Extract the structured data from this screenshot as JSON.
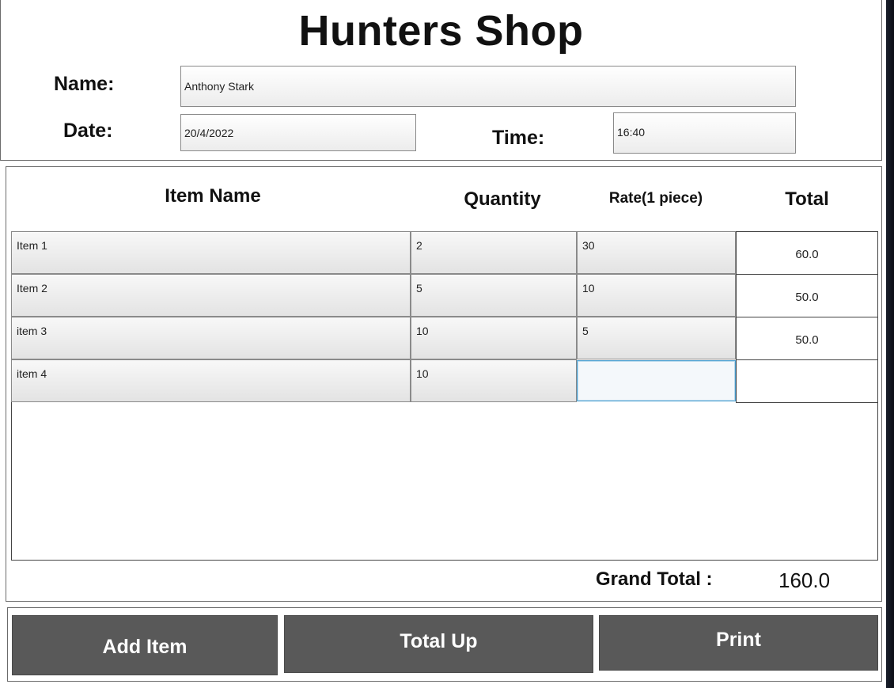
{
  "app": {
    "title": "Hunters Shop"
  },
  "header": {
    "name_label": "Name:",
    "name_value": "Anthony Stark",
    "date_label": "Date:",
    "date_value": "20/4/2022",
    "time_label": "Time:",
    "time_value": "16:40"
  },
  "table": {
    "columns": [
      "Item Name",
      "Quantity",
      "Rate(1 piece)",
      "Total"
    ],
    "rows": [
      {
        "item": "Item 1",
        "quantity": "2",
        "rate": "30",
        "total": "60.0"
      },
      {
        "item": "Item 2",
        "quantity": "5",
        "rate": "10",
        "total": "50.0"
      },
      {
        "item": "item 3",
        "quantity": "10",
        "rate": "5",
        "total": "50.0"
      },
      {
        "item": "item 4",
        "quantity": "10",
        "rate": "",
        "total": ""
      }
    ]
  },
  "summary": {
    "grand_total_label": "Grand Total :",
    "grand_total_value": "160.0"
  },
  "buttons": {
    "add_item": "Add Item",
    "total_up": "Total Up",
    "print": "Print"
  },
  "colors": {
    "button_bg": "#595959",
    "button_text": "#ffffff",
    "focus_border": "#4a9fd0",
    "panel_border": "#6b6b6b"
  }
}
